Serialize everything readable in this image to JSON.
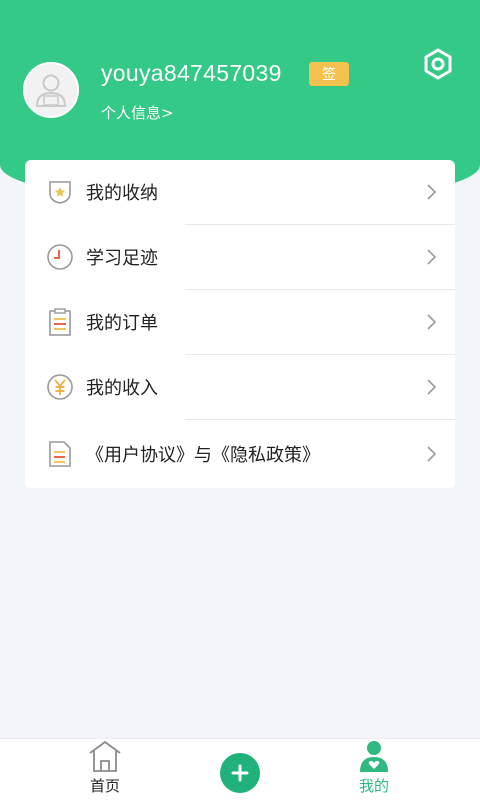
{
  "profile": {
    "username": "youya847457039",
    "sign_badge": "签",
    "info_link": "个人信息>"
  },
  "menu": {
    "items": [
      {
        "label": "我的收纳",
        "icon": "shield-star-icon"
      },
      {
        "label": "学习足迹",
        "icon": "clock-icon"
      },
      {
        "label": "我的订单",
        "icon": "clipboard-icon"
      },
      {
        "label": "我的收入",
        "icon": "yuan-coin-icon"
      },
      {
        "label": "《用户协议》与《隐私政策》",
        "icon": "document-icon"
      }
    ]
  },
  "nav": {
    "home_label": "首页",
    "mine_label": "我的"
  },
  "colors": {
    "brand": "#34c987",
    "accent_dark": "#20b27a",
    "badge": "#f2c14e",
    "active_nav": "#2fb980"
  }
}
